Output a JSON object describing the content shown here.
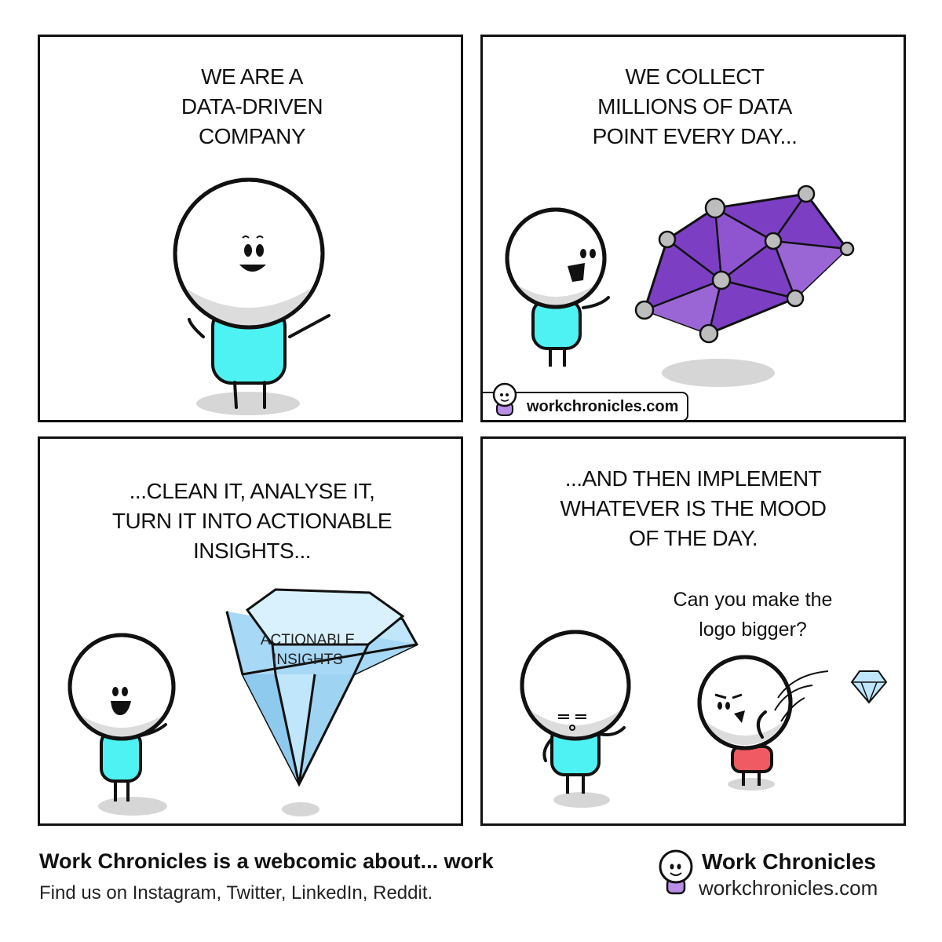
{
  "panels": {
    "p1": {
      "caption": "WE ARE A\nDATA-DRIVEN\nCOMPANY"
    },
    "p2": {
      "caption": "WE COLLECT\nMILLIONS OF DATA\nPOINT EVERY DAY...",
      "badge": "workchronicles.com"
    },
    "p3": {
      "caption": "...CLEAN IT, ANALYSE IT,\nTURN IT INTO ACTIONABLE\nINSIGHTS...",
      "gem_label": "ACTIONABLE\nINSIGHTS"
    },
    "p4": {
      "caption": "...AND THEN IMPLEMENT\nWHATEVER IS THE MOOD\nOF THE DAY.",
      "speech": "Can you make the\nlogo bigger?"
    }
  },
  "footer": {
    "title": "Work Chronicles is a webcomic about... work",
    "subtitle": "Find us on Instagram, Twitter, LinkedIn, Reddit.",
    "brand_name": "Work Chronicles",
    "brand_url": "workchronicles.com"
  },
  "colors": {
    "ink": "#111111",
    "shirt_cyan": "#4ef2f2",
    "shirt_red": "#f05a62",
    "data_purple": "#7c3fc4",
    "diamond_blue": "#bfe6fb",
    "shadow_grey": "#d6d6d6"
  },
  "icons": [
    "stick-figure-icon",
    "data-network-icon",
    "diamond-icon",
    "workchronicles-logo-icon"
  ]
}
